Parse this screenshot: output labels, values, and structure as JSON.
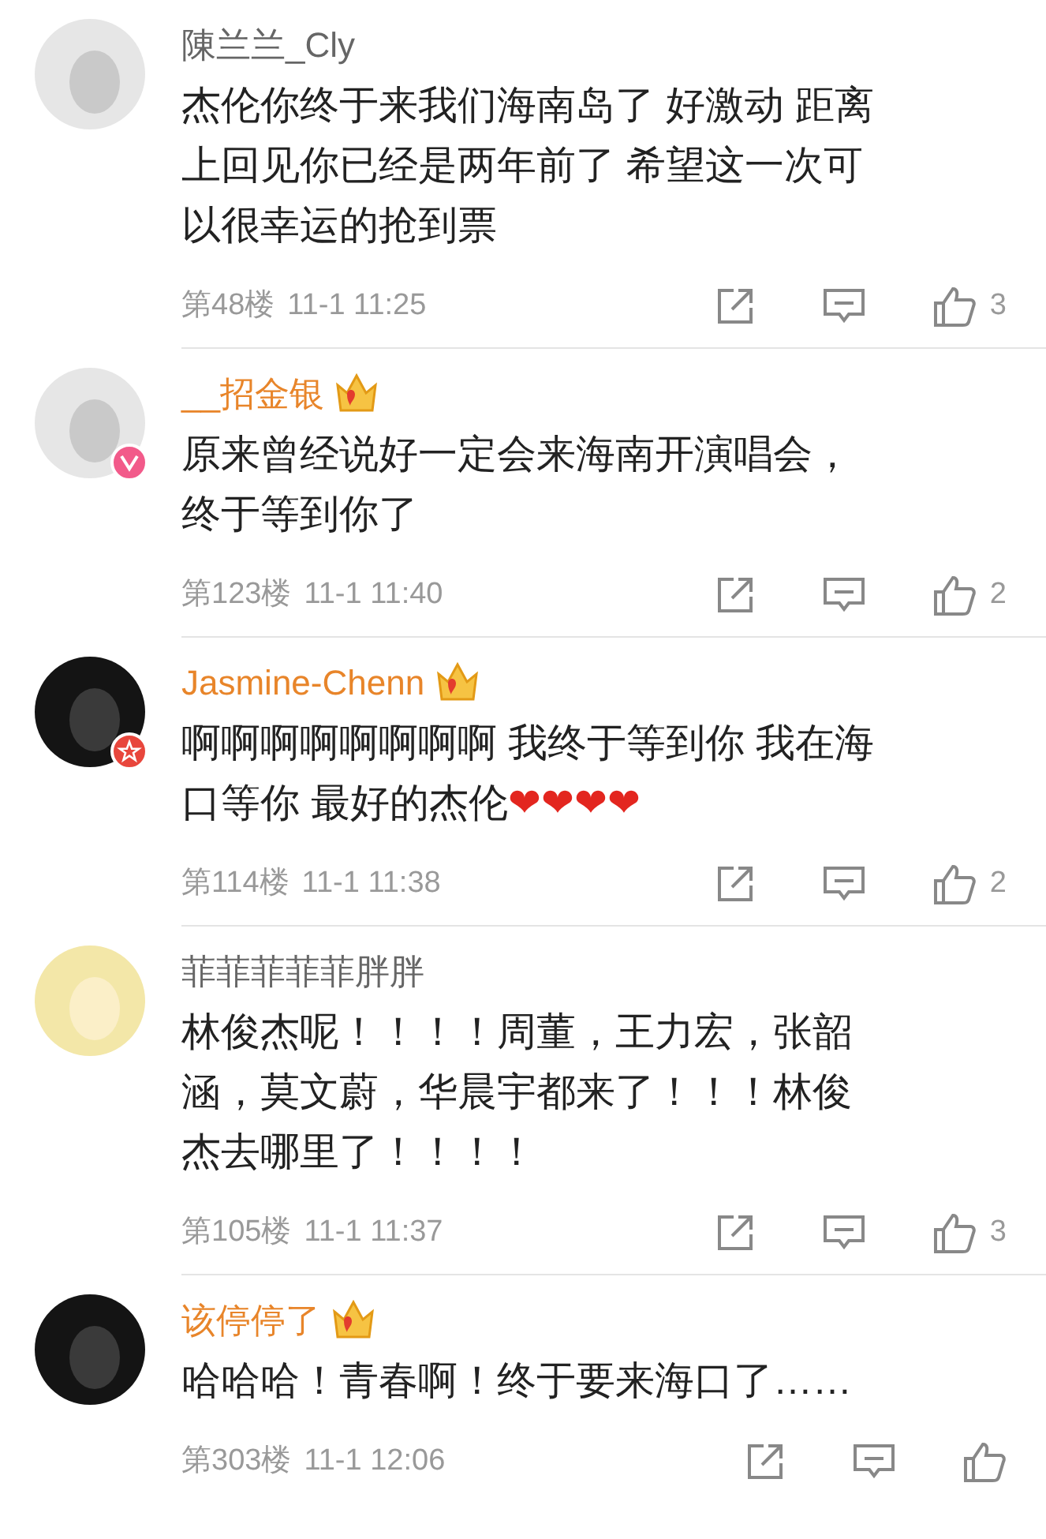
{
  "comments": [
    {
      "name": "陳兰兰_Cly",
      "vip": false,
      "avatar": {
        "kind": "light"
      },
      "lines": [
        "杰伦你终于来我们海南岛了 好激动 距离",
        "上回见你已经是两年前了 希望这一次可",
        "以很幸运的抢到票"
      ],
      "floor": "第48楼",
      "time": "11-1 11:25",
      "likes": "3"
    },
    {
      "name": "__招金银",
      "vip": true,
      "badge": {
        "kind": "v"
      },
      "avatar": {
        "kind": "light"
      },
      "lines": [
        "原来曾经说好一定会来海南开演唱会，",
        "终于等到你了"
      ],
      "floor": "第123楼",
      "time": "11-1 11:40",
      "likes": "2"
    },
    {
      "name": "Jasmine-Chenn",
      "vip": true,
      "badge": {
        "kind": "star"
      },
      "avatar": {
        "kind": "dark"
      },
      "lines": [
        "啊啊啊啊啊啊啊啊 我终于等到你 我在海",
        "口等你 最好的杰伦"
      ],
      "emoji": "❤❤❤❤",
      "floor": "第114楼",
      "time": "11-1 11:38",
      "likes": "2"
    },
    {
      "name": "菲菲菲菲菲胖胖",
      "vip": false,
      "avatar": {
        "kind": "cartoon"
      },
      "lines": [
        "林俊杰呢！！！！周董，王力宏，张韶",
        "涵，莫文蔚，华晨宇都来了！！！林俊",
        "杰去哪里了！！！！"
      ],
      "floor": "第105楼",
      "time": "11-1 11:37",
      "likes": "3"
    },
    {
      "name": "该停停了",
      "vip": true,
      "avatar": {
        "kind": "dark"
      },
      "lines": [
        "哈哈哈！青春啊！终于要来海口了……"
      ],
      "floor": "第303楼",
      "time": "11-1 12:06"
    }
  ]
}
